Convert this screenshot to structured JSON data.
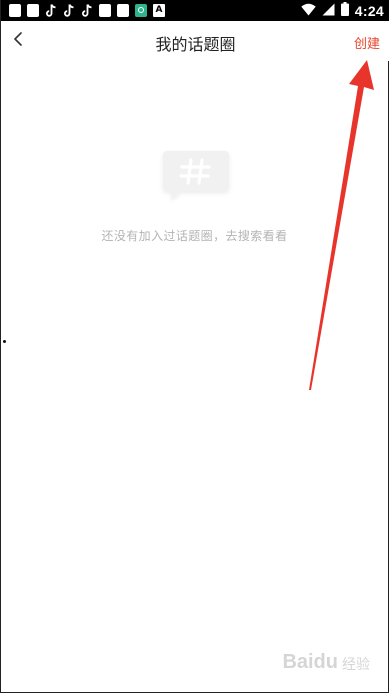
{
  "status_bar": {
    "time": "4:24",
    "left_icons": [
      "app-icon",
      "app-icon",
      "tiktok-icon",
      "tiktok-icon",
      "tiktok-icon",
      "app-icon",
      "app-icon",
      "green-app-icon",
      "a-app-icon"
    ],
    "a_icon_label": "A",
    "right_icons": [
      "wifi-icon",
      "signal-icon",
      "battery-icon"
    ]
  },
  "header": {
    "back_icon": "chevron-left-icon",
    "title": "我的话题圈",
    "create_label": "创建"
  },
  "empty_state": {
    "icon": "hashtag-chat-icon",
    "message": "还没有加入过话题圈，去搜索看看"
  },
  "annotation": {
    "arrow_color": "#e8352b"
  },
  "watermark": {
    "logo": "Baidu",
    "sub": "经验"
  },
  "colors": {
    "accent": "#e8452f",
    "muted_text": "#b4b4b4",
    "title_text": "#222222"
  }
}
